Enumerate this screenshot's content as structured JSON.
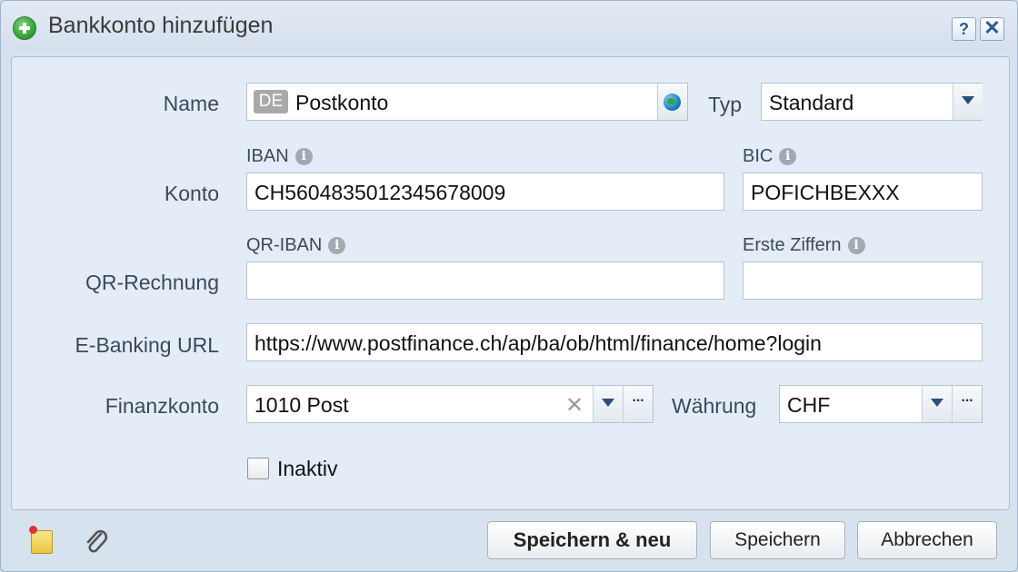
{
  "dialog": {
    "title": "Bankkonto hinzufügen",
    "help_label": "?",
    "close_label": "✕"
  },
  "form": {
    "name_label": "Name",
    "name_lang": "DE",
    "name_value": "Postkonto",
    "typ_label": "Typ",
    "typ_value": "Standard",
    "konto_label": "Konto",
    "iban_label": "IBAN",
    "iban_value": "CH5604835012345678009",
    "bic_label": "BIC",
    "bic_value": "POFICHBEXXX",
    "qr_label": "QR-Rechnung",
    "qr_iban_label": "QR-IBAN",
    "qr_iban_value": "",
    "erste_ziffern_label": "Erste Ziffern",
    "erste_ziffern_value": "",
    "ebanking_label": "E-Banking URL",
    "ebanking_value": "https://www.postfinance.ch/ap/ba/ob/html/finance/home?login",
    "finanzkonto_label": "Finanzkonto",
    "finanzkonto_value": "1010 Post",
    "waehrung_label": "Währung",
    "waehrung_value": "CHF",
    "inaktiv_label": "Inaktiv",
    "inaktiv_checked": false,
    "info_glyph": "i",
    "more_glyph": "···",
    "clear_glyph": "✕"
  },
  "footer": {
    "save_new_label": "Speichern & neu",
    "save_label": "Speichern",
    "cancel_label": "Abbrechen"
  }
}
